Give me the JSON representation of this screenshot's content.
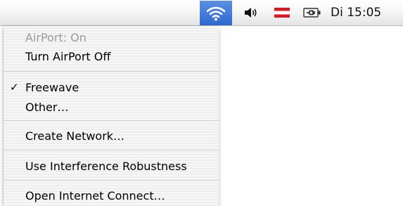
{
  "menubar": {
    "icons": {
      "wifi": "wifi-icon",
      "volume": "speaker-volume-icon",
      "flag": "austria-flag-icon",
      "battery": "battery-plugged-icon"
    },
    "clock": "Di 15:05",
    "colors": {
      "wifi_highlight": "#3a74d8",
      "flag_red": "#e0141e"
    }
  },
  "menu": {
    "status": "AirPort: On",
    "turn_off": "Turn AirPort Off",
    "checkmark": "✓",
    "network_selected": "Freewave",
    "other": "Other…",
    "create_network": "Create Network…",
    "interference": "Use Interference Robustness",
    "open_internet_connect": "Open Internet Connect…"
  }
}
